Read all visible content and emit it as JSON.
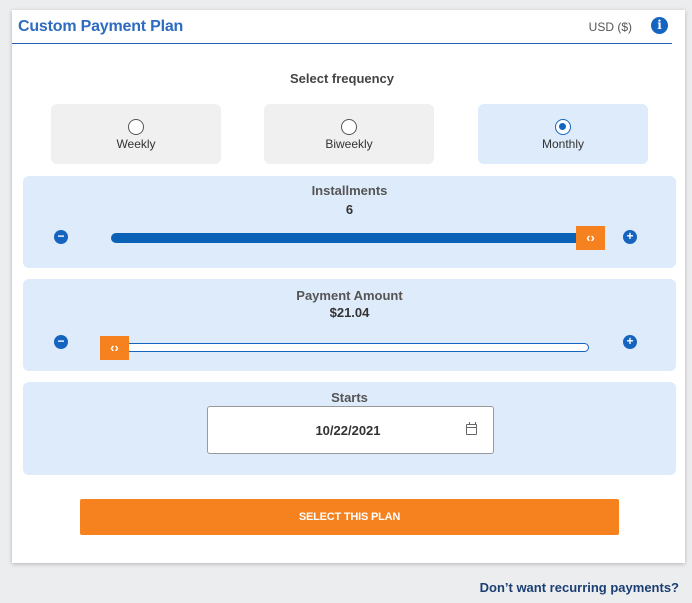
{
  "header": {
    "title": "Custom Payment Plan",
    "currency": "USD ($)",
    "info_icon": "info-icon"
  },
  "frequency": {
    "label": "Select frequency",
    "options": [
      {
        "label": "Weekly",
        "selected": false
      },
      {
        "label": "Biweekly",
        "selected": false
      },
      {
        "label": "Monthly",
        "selected": true
      }
    ],
    "selected_value": "Monthly"
  },
  "installments": {
    "title": "Installments",
    "value": "6",
    "slider_level": 1.0,
    "decrement_icon": "minus-icon",
    "increment_icon": "plus-icon",
    "thumb_glyph": "‹›"
  },
  "payment_amount": {
    "title": "Payment Amount",
    "value": "$21.04",
    "slider_level": 0.0,
    "decrement_icon": "minus-icon",
    "increment_icon": "plus-icon",
    "thumb_glyph": "‹›"
  },
  "starts": {
    "title": "Starts",
    "date": "10/22/2021",
    "icon": "calendar-icon"
  },
  "actions": {
    "select_plan": "SELECT THIS PLAN",
    "no_recurring": "Don’t want recurring payments?"
  },
  "colors": {
    "accent_blue": "#1565c0",
    "title_blue": "#2d6cc0",
    "orange": "#f6821f",
    "panel_bg": "#deebfb"
  }
}
